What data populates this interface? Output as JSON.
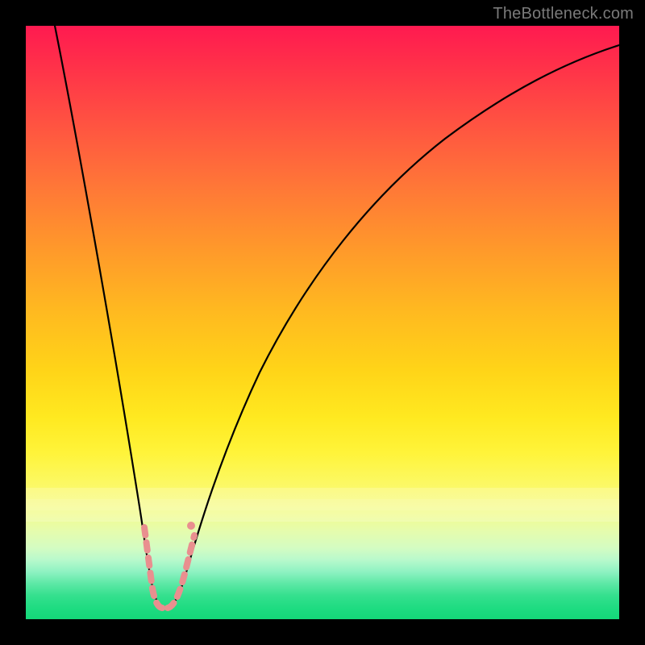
{
  "watermark": {
    "text": "TheBottleneck.com"
  },
  "chart_data": {
    "type": "line",
    "title": "",
    "xlabel": "",
    "ylabel": "",
    "xlim": [
      0,
      100
    ],
    "ylim": [
      0,
      100
    ],
    "grid": false,
    "legend": false,
    "notes": "Black V-shaped curve over rainbow gradient; minimum near x≈23. Pink dashed overlay segments appear near the minimum. Values estimated from pixels.",
    "series": [
      {
        "name": "curve",
        "color": "#000000",
        "x": [
          5,
          7,
          9,
          11,
          13,
          15,
          17,
          19,
          20,
          21,
          22,
          23,
          24,
          25,
          26,
          27,
          29,
          31,
          34,
          38,
          43,
          50,
          58,
          67,
          78,
          90,
          100
        ],
        "values": [
          100,
          88,
          76,
          65,
          54,
          43,
          33,
          22,
          16,
          10,
          5,
          2,
          2,
          3,
          6,
          10,
          18,
          26,
          36,
          46,
          55,
          64,
          72,
          79,
          85,
          90,
          93
        ]
      },
      {
        "name": "highlight-dots",
        "color": "#e98f8f",
        "type": "scatter",
        "x": [
          20.0,
          20.3,
          20.6,
          21.8,
          23.0,
          24.2,
          25.5,
          26.4,
          26.8,
          27.0
        ],
        "values": [
          14.0,
          12.5,
          11.0,
          3.8,
          2.0,
          2.0,
          3.5,
          8.0,
          10.0,
          12.0
        ]
      }
    ]
  }
}
